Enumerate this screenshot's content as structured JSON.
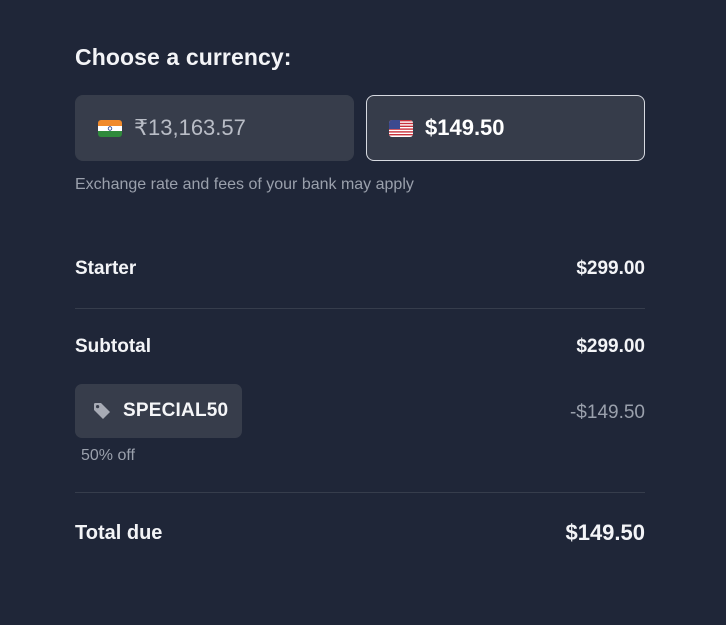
{
  "currency": {
    "title": "Choose a currency:",
    "options": [
      {
        "flag": "india-flag-icon",
        "amount": "₹13,163.57",
        "selected": false
      },
      {
        "flag": "us-flag-icon",
        "amount": "$149.50",
        "selected": true
      }
    ],
    "note": "Exchange rate and fees of your bank may apply"
  },
  "summary": {
    "item": {
      "label": "Starter",
      "value": "$299.00"
    },
    "subtotal": {
      "label": "Subtotal",
      "value": "$299.00"
    },
    "promo": {
      "code": "SPECIAL50",
      "discount": "-$149.50",
      "description": "50% off"
    },
    "total": {
      "label": "Total due",
      "value": "$149.50"
    }
  },
  "colors": {
    "background": "#1f2638",
    "button": "#373d4b",
    "selected_border": "#d7dae1",
    "muted_text": "#9aa0ac"
  }
}
